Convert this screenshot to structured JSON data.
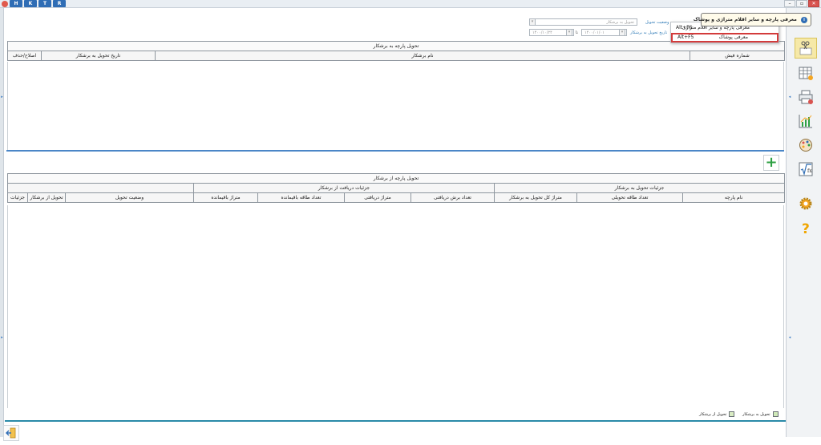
{
  "titlebar": {
    "letters": [
      "H",
      "K",
      "T",
      "R"
    ],
    "controls": {
      "minimize": "–",
      "restore": "▫",
      "close": "✕"
    }
  },
  "filters": {
    "status_label": "وضعیت تحویل",
    "status_value": "تحویل به برشکار",
    "date_label": "تاریخ تحویل به برشکار",
    "date_from": "۱۴۰۰/۰۱/۰۱",
    "date_to_label": "تا",
    "date_to": "۱۴۰۰/۱۰/۲۴"
  },
  "top_grid": {
    "caption": "تحویل پارچه به برشکار",
    "columns": [
      "شماره فیش",
      "نام برشکار",
      "تاریخ تحویل به برشکار",
      "اصلاح/حذف"
    ]
  },
  "bottom_grid": {
    "caption": "تحویل پارچه از برشکار",
    "group_delivery": "جزئیات تحویل به برشکار",
    "group_received": "جزئیات دریافت از برشکار",
    "columns": [
      "نام پارچه",
      "تعداد طاقه تحویلی",
      "متراژ کل تحویل به برشکار",
      "تعداد برش دریافتی",
      "متراژ دریافتی",
      "تعداد طاقه باقیمانده",
      "متراژ باقیمانده",
      "وضعیت تحویل",
      "تحویل از برشکار",
      "جزئیات"
    ]
  },
  "legend": {
    "to_cutter": "تحویل به برشکار",
    "from_cutter": "تحویل از برشکار"
  },
  "tooltip": {
    "title": "معرفی پارچه و سایر اقلام متراژی و پوشاک"
  },
  "menu": {
    "items": [
      {
        "label": "معرفی پارچه و سایر اقلام متراژی",
        "shortcut": "Alt+F6"
      },
      {
        "label": "معرفی پوشاک",
        "shortcut": "Alt+F5"
      }
    ]
  },
  "sidebar": {
    "icons": [
      "scissors-icon",
      "table-icon",
      "print-icon",
      "chart-icon",
      "palette-icon",
      "formula-icon",
      "settings-icon",
      "help-icon"
    ]
  },
  "colors": {
    "accent": "#2a8aa8",
    "active": "#f6e9a8",
    "highlight": "#d33b3b",
    "add": "#2ea043"
  }
}
